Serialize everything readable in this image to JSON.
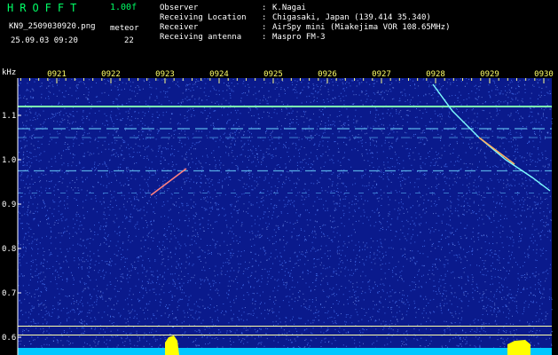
{
  "header": {
    "app_title": "HROFFT",
    "version": "1.00f",
    "filename": "KN9_2509030920.png",
    "datetime": "25.09.03 09:20",
    "meteor_label": "meteor",
    "meteor_count": "22",
    "info": [
      {
        "key": "Observer",
        "value": "K.Nagai"
      },
      {
        "key": "Receiving Location",
        "value": "Chigasaki, Japan (139.414 35.340)"
      },
      {
        "key": "Receiver",
        "value": "AirSpy mini (Miakejima VOR 108.65MHz)"
      },
      {
        "key": "Receiving antenna",
        "value": "Maspro FM-3"
      }
    ]
  },
  "chart_data": {
    "type": "heatmap",
    "title": "",
    "xlabel": "",
    "ylabel": "kHz",
    "x_ticks": [
      "0921",
      "0922",
      "0923",
      "0924",
      "0925",
      "0926",
      "0927",
      "0928",
      "0929",
      "0930"
    ],
    "y_ticks": [
      "1.1",
      "1.0",
      "0.9",
      "0.8",
      "0.7",
      "0.6"
    ],
    "ylim": [
      0.58,
      1.14
    ],
    "colors": {
      "background": "#0a1a8c",
      "noise": "#4f7fff",
      "signal": "#00ffff",
      "hot": "#ffff00",
      "grid": "#ffff88"
    }
  }
}
